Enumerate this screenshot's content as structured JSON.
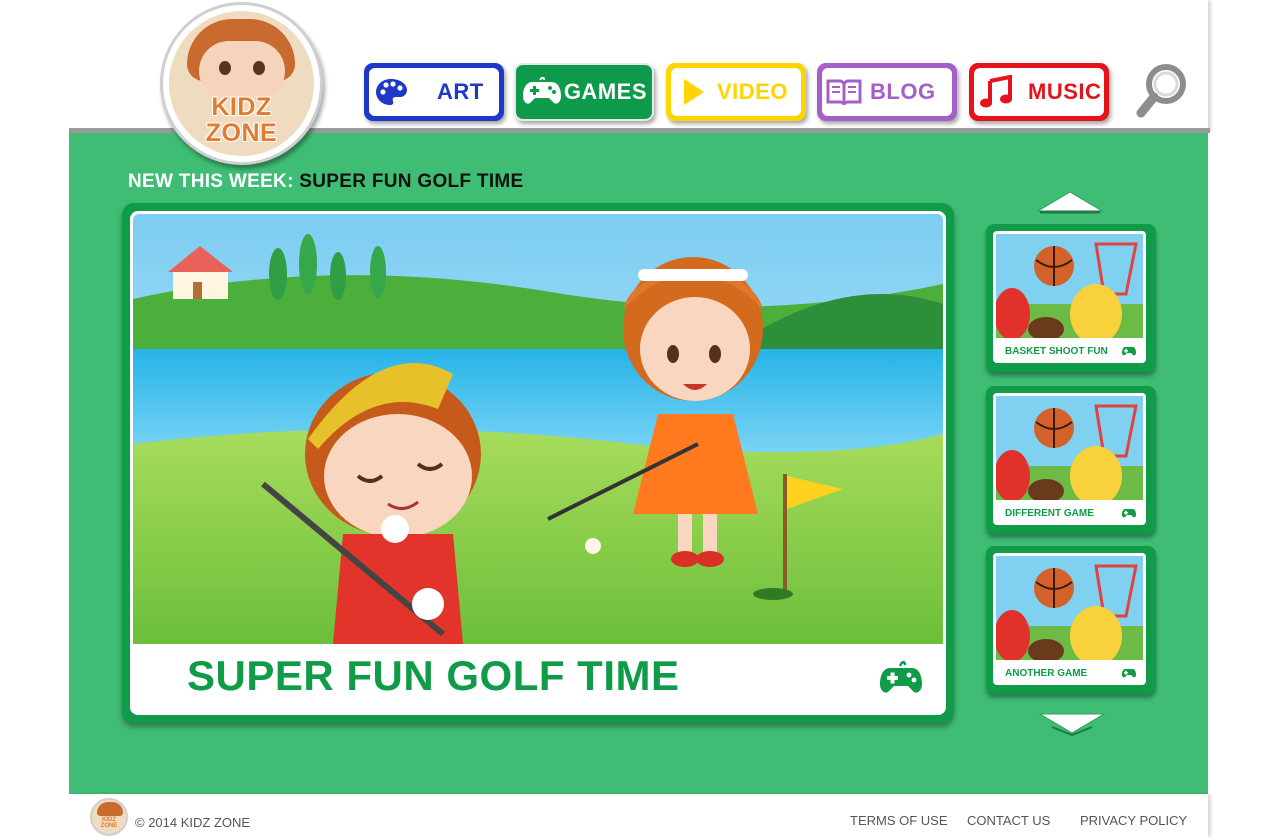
{
  "brand": {
    "logo_line1": "KIDZ",
    "logo_line2": "ZONE"
  },
  "nav": {
    "items": [
      {
        "label": "ART",
        "icon": "palette-icon",
        "color": "#1e38c8"
      },
      {
        "label": "GAMES",
        "icon": "gamepad-icon",
        "color": "#0d9a4b",
        "active": true
      },
      {
        "label": "VIDEO",
        "icon": "play-icon",
        "color": "#ffd400"
      },
      {
        "label": "BLOG",
        "icon": "book-icon",
        "color": "#a55fc9"
      },
      {
        "label": "MUSIC",
        "icon": "music-note-icon",
        "color": "#e5131b"
      }
    ],
    "search_icon": "magnifier-icon"
  },
  "featured": {
    "heading_prefix": "NEW THIS WEEK:",
    "heading_name": "SUPER FUN GOLF TIME",
    "title": "SUPER FUN GOLF TIME",
    "icon": "gamepad-icon"
  },
  "carousel": {
    "up_icon": "arrow-up-icon",
    "down_icon": "arrow-down-icon",
    "items": [
      {
        "label": "BASKET SHOOT FUN",
        "icon": "gamepad-icon"
      },
      {
        "label": "DIFFERENT GAME",
        "icon": "gamepad-icon"
      },
      {
        "label": "ANOTHER GAME",
        "icon": "gamepad-icon"
      }
    ]
  },
  "footer": {
    "copyright": "© 2014 KIDZ ZONE",
    "links": [
      "TERMS OF USE",
      "CONTACT US",
      "PRIVACY POLICY"
    ]
  },
  "colors": {
    "main_green": "#3fbd75",
    "dark_green": "#0f9b47",
    "logo_orange": "#e27b2f"
  }
}
